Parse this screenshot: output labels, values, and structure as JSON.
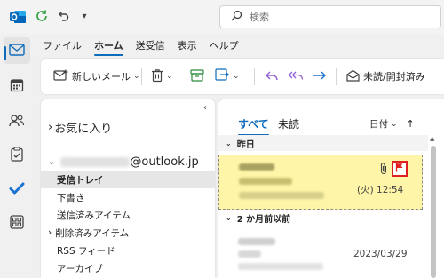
{
  "search": {
    "placeholder": "検索"
  },
  "menu": {
    "items": [
      {
        "label": "ファイル",
        "active": false
      },
      {
        "label": "ホーム",
        "active": true
      },
      {
        "label": "送受信",
        "active": false
      },
      {
        "label": "表示",
        "active": false
      },
      {
        "label": "ヘルプ",
        "active": false
      }
    ]
  },
  "ribbon": {
    "new_mail_label": "新しいメール",
    "read_unread_label": "未読/開封済み"
  },
  "folder_pane": {
    "favorites_label": "お気に入り",
    "account_email": "@outlook.jp",
    "folders": [
      {
        "label": "受信トレイ",
        "selected": true
      },
      {
        "label": "下書き",
        "selected": false
      },
      {
        "label": "送信済みアイテム",
        "selected": false
      },
      {
        "label": "削除済みアイテム",
        "selected": false,
        "expandable": true
      },
      {
        "label": "RSS フィード",
        "selected": false
      },
      {
        "label": "アーカイブ",
        "selected": false
      }
    ]
  },
  "message_list": {
    "tabs": [
      {
        "label": "すべて",
        "active": true
      },
      {
        "label": "未読",
        "active": false
      }
    ],
    "sort_label": "日付",
    "groups": [
      {
        "label": "昨日"
      },
      {
        "label": "2 か月前以前"
      }
    ],
    "messages": [
      {
        "time": "(火) 12:54",
        "has_attachment": true,
        "flagged": true,
        "highlighted": true
      },
      {
        "time": "2023/03/29",
        "has_attachment": false,
        "flagged": false,
        "highlighted": false
      }
    ]
  },
  "colors": {
    "accent": "#0f6cbd",
    "flag_red": "#e02020",
    "highlight_yellow": "#fff5a8",
    "undo_purple": "#8f5fd6"
  }
}
